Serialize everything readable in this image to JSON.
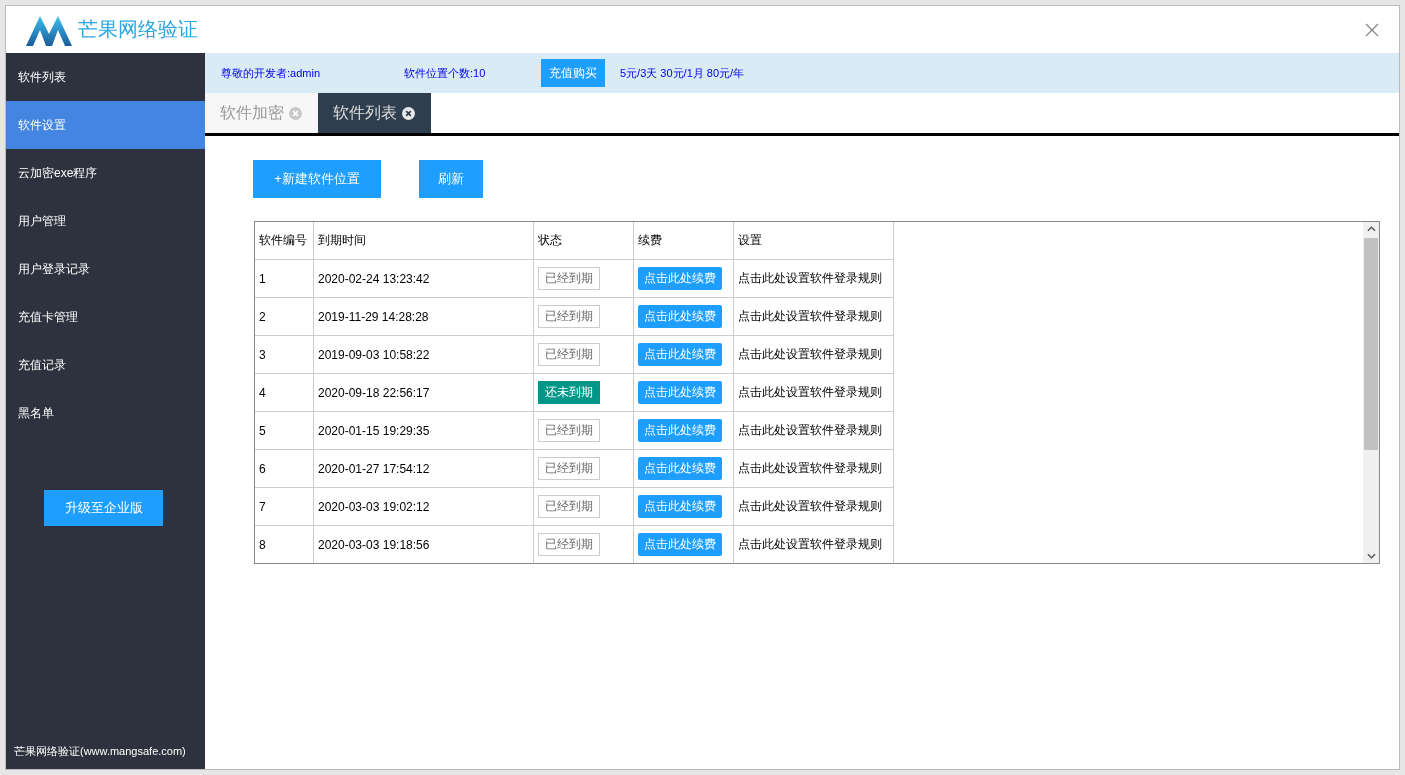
{
  "brand": {
    "title": "芒果网络验证"
  },
  "sidebar": {
    "items": [
      {
        "label": "软件列表",
        "selected": false
      },
      {
        "label": "软件设置",
        "selected": true
      },
      {
        "label": "云加密exe程序",
        "selected": false
      },
      {
        "label": "用户管理",
        "selected": false
      },
      {
        "label": "用户登录记录",
        "selected": false
      },
      {
        "label": "充值卡管理",
        "selected": false
      },
      {
        "label": "充值记录",
        "selected": false
      },
      {
        "label": "黑名单",
        "selected": false
      }
    ],
    "upgrade_button": "升级至企业版",
    "footer": "芒果网络验证(www.mangsafe.com)"
  },
  "info_bar": {
    "developer": "尊敬的开发者:admin",
    "slots": "软件位置个数:10",
    "buy_button": "充值购买",
    "prices": "5元/3天 30元/1月 80元/年"
  },
  "tabs": [
    {
      "label": "软件加密",
      "selected": false
    },
    {
      "label": "软件列表",
      "selected": true
    }
  ],
  "toolbar": {
    "new_button": "+新建软件位置",
    "refresh_button": "刷新"
  },
  "table": {
    "columns": [
      "软件编号",
      "到期时间",
      "状态",
      "续费",
      "设置"
    ],
    "rows": [
      {
        "id": "1",
        "expires": "2020-02-24 13:23:42",
        "status": "已经到期",
        "kind": "expired",
        "renew": "点击此处续费",
        "settings": "点击此处设置软件登录规则"
      },
      {
        "id": "2",
        "expires": "2019-11-29 14:28:28",
        "status": "已经到期",
        "kind": "expired",
        "renew": "点击此处续费",
        "settings": "点击此处设置软件登录规则"
      },
      {
        "id": "3",
        "expires": "2019-09-03 10:58:22",
        "status": "已经到期",
        "kind": "expired",
        "renew": "点击此处续费",
        "settings": "点击此处设置软件登录规则"
      },
      {
        "id": "4",
        "expires": "2020-09-18 22:56:17",
        "status": "还未到期",
        "kind": "active",
        "renew": "点击此处续费",
        "settings": "点击此处设置软件登录规则"
      },
      {
        "id": "5",
        "expires": "2020-01-15 19:29:35",
        "status": "已经到期",
        "kind": "expired",
        "renew": "点击此处续费",
        "settings": "点击此处设置软件登录规则"
      },
      {
        "id": "6",
        "expires": "2020-01-27 17:54:12",
        "status": "已经到期",
        "kind": "expired",
        "renew": "点击此处续费",
        "settings": "点击此处设置软件登录规则"
      },
      {
        "id": "7",
        "expires": "2020-03-03 19:02:12",
        "status": "已经到期",
        "kind": "expired",
        "renew": "点击此处续费",
        "settings": "点击此处设置软件登录规则"
      },
      {
        "id": "8",
        "expires": "2020-03-03 19:18:56",
        "status": "已经到期",
        "kind": "expired",
        "renew": "点击此处续费",
        "settings": "点击此处设置软件登录规则"
      }
    ]
  }
}
